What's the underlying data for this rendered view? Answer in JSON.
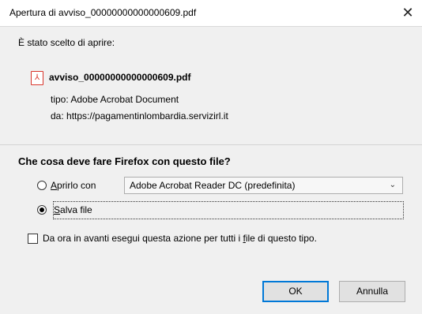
{
  "window": {
    "title": "Apertura di avviso_00000000000000609.pdf",
    "close": "✕"
  },
  "info": {
    "intro": "È stato scelto di aprire:",
    "filename": "avviso_00000000000000609.pdf",
    "type_label": "tipo:",
    "type_value": "Adobe Acrobat Document",
    "from_label": "da:",
    "from_value": "https://pagamentinlombardia.servizirl.it"
  },
  "question": "Che cosa deve fare Firefox con questo file?",
  "options": {
    "open_with_prefix": "",
    "open_with_access": "A",
    "open_with_rest": "prirlo con",
    "app_select_value": "Adobe Acrobat Reader DC  (predefinita)",
    "save_access": "S",
    "save_rest": "alva file"
  },
  "remember": {
    "pre": "Da ora in avanti esegui questa azione per tutti i ",
    "access": "f",
    "post": "ile di questo tipo."
  },
  "buttons": {
    "ok": "OK",
    "cancel": "Annulla"
  }
}
